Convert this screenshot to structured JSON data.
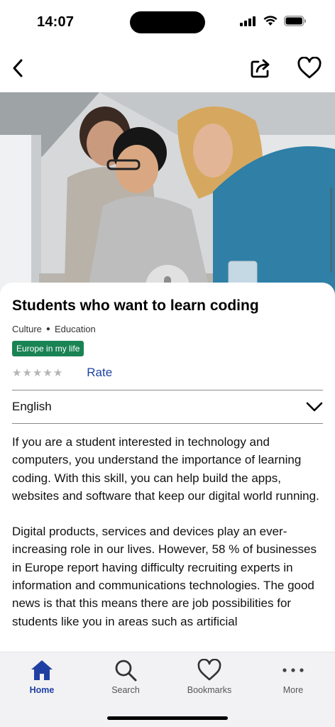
{
  "status_bar": {
    "time": "14:07"
  },
  "header": {
    "back_icon": "chevron-left-icon",
    "share_icon": "share-icon",
    "favorite_icon": "heart-icon"
  },
  "hero": {
    "mic_icon": "microphone-icon"
  },
  "article": {
    "title": "Students who want to learn coding",
    "categories": [
      "Culture",
      "Education"
    ],
    "badge": "Europe in my life",
    "badge_color": "#1a8354",
    "rating": 0,
    "rating_max": 5,
    "rate_label": "Rate",
    "language": "English",
    "paragraphs": [
      "If you are a student interested in technology and computers, you understand the importance of learning coding. With this skill, you can help build the apps, websites and software that keep our digital world running.",
      "Digital products, services and devices play an ever-increasing role in our lives. However, 58 % of businesses in Europe report having difficulty recruiting experts in information and communications technologies. The good news is that this means there are job possibilities for students like you in areas such as artificial"
    ]
  },
  "tabs": [
    {
      "label": "Home",
      "icon": "home-icon",
      "active": true
    },
    {
      "label": "Search",
      "icon": "search-icon",
      "active": false
    },
    {
      "label": "Bookmarks",
      "icon": "heart-icon",
      "active": false
    },
    {
      "label": "More",
      "icon": "more-icon",
      "active": false
    }
  ],
  "colors": {
    "accent": "#1f3fa3",
    "link": "#1f43a4"
  }
}
